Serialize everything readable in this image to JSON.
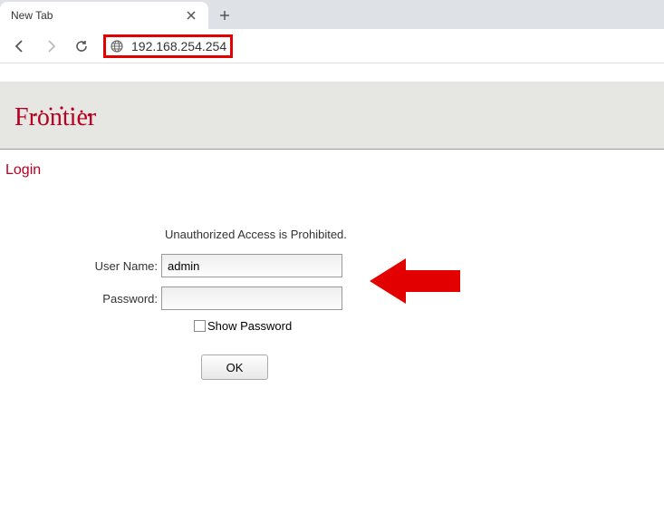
{
  "browser": {
    "tab_title": "New Tab",
    "address": "192.168.254.254"
  },
  "page": {
    "brand": "Frontier",
    "heading": "Login",
    "warning": "Unauthorized Access is Prohibited.",
    "labels": {
      "username": "User Name:",
      "password": "Password:",
      "show_password": "Show Password"
    },
    "values": {
      "username": "admin",
      "password": ""
    },
    "buttons": {
      "ok": "OK"
    }
  }
}
